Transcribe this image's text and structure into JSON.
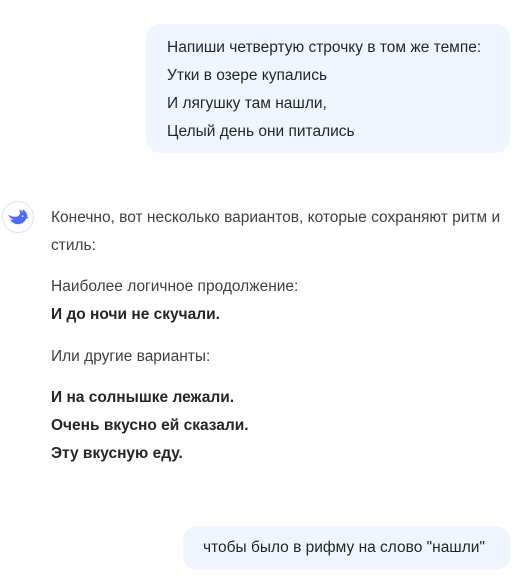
{
  "user_message_1": {
    "lines": [
      "Напиши четвертую строчку в том же темпе:",
      "Утки в озере купались",
      "И лягушку там нашли,",
      "Целый день они питались"
    ]
  },
  "assistant_message": {
    "intro": "Конечно, вот несколько вариантов, которые сохраняют ритм и стиль:",
    "logical_label": "Наиболее логичное продолжение:",
    "logical_variant": "И до ночи не скучали.",
    "other_label": "Или другие варианты:",
    "other_variants": [
      "И на солнышке лежали.",
      "Очень вкусно ей сказали.",
      "Эту вкусную еду."
    ]
  },
  "user_message_2": {
    "text": "чтобы было в рифму на слово \"нашли\""
  },
  "colors": {
    "user_bubble_bg": "#eff6ff",
    "assistant_logo": "#4d6bfe",
    "text": "#404040"
  },
  "icons": {
    "assistant_avatar": "whale-logo-icon"
  }
}
